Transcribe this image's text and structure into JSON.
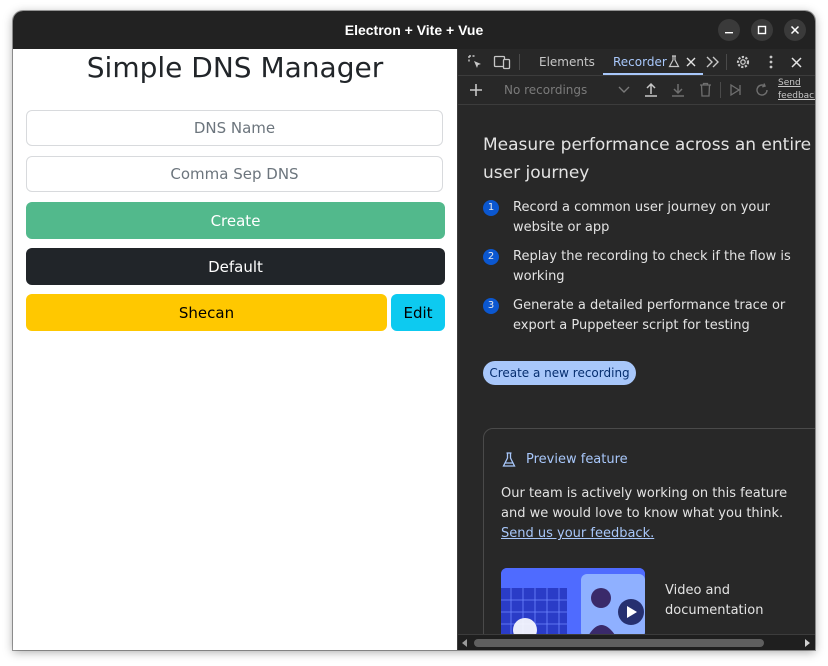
{
  "window": {
    "title": "Electron + Vite + Vue"
  },
  "app": {
    "heading": "Simple DNS Manager",
    "dns_name_placeholder": "DNS Name",
    "dns_list_placeholder": "Comma Sep DNS",
    "create_label": "Create",
    "default_label": "Default",
    "profiles": [
      {
        "name": "Shecan",
        "edit_label": "Edit"
      }
    ],
    "colors": {
      "create": "#52b98c",
      "default": "#212529",
      "profile": "#ffc800",
      "edit": "#0dcaf0"
    }
  },
  "devtools": {
    "tabs": {
      "elements": "Elements",
      "recorder": "Recorder"
    },
    "toolbar": {
      "recordings_select": "No recordings",
      "send_feedback_1": "Send",
      "send_feedback_2": "feedback"
    },
    "heading": "Measure performance across an entire user journey",
    "steps": [
      {
        "num": "1",
        "text": "Record a common user journey on your website or app"
      },
      {
        "num": "2",
        "text": "Replay the recording to check if the flow is working"
      },
      {
        "num": "3",
        "text": "Generate a detailed performance trace or export a Puppeteer script for testing"
      }
    ],
    "create_recording": "Create a new recording",
    "preview": {
      "title": "Preview feature",
      "body": "Our team is actively working on this feature and we would love to know what you think.",
      "link": "Send us your feedback.",
      "video_label": "Video and documentation"
    }
  }
}
